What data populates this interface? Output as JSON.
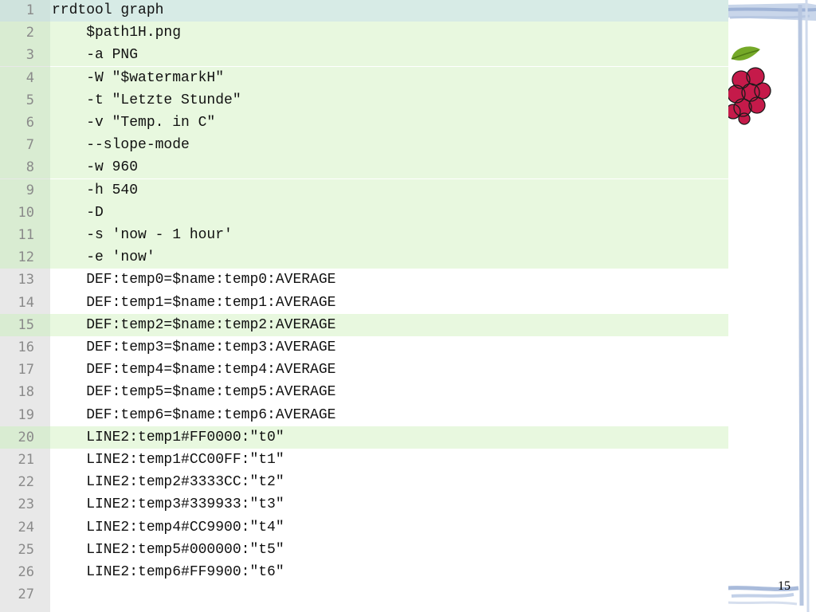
{
  "editor": {
    "lines": [
      {
        "no": "1",
        "text": "rrdtool graph"
      },
      {
        "no": "2",
        "text": "    $path1H.png"
      },
      {
        "no": "3",
        "text": "    -a PNG"
      },
      {
        "no": "4",
        "text": "    -W \"$watermarkH\""
      },
      {
        "no": "5",
        "text": "    -t \"Letzte Stunde\""
      },
      {
        "no": "6",
        "text": "    -v \"Temp. in C\""
      },
      {
        "no": "7",
        "text": "    --slope-mode"
      },
      {
        "no": "8",
        "text": "    -w 960"
      },
      {
        "no": "9",
        "text": "    -h 540"
      },
      {
        "no": "10",
        "text": "    -D"
      },
      {
        "no": "11",
        "text": "    -s 'now - 1 hour'"
      },
      {
        "no": "12",
        "text": "    -e 'now'"
      },
      {
        "no": "13",
        "text": "    DEF:temp0=$name:temp0:AVERAGE"
      },
      {
        "no": "14",
        "text": "    DEF:temp1=$name:temp1:AVERAGE"
      },
      {
        "no": "15",
        "text": "    DEF:temp2=$name:temp2:AVERAGE"
      },
      {
        "no": "16",
        "text": "    DEF:temp3=$name:temp3:AVERAGE"
      },
      {
        "no": "17",
        "text": "    DEF:temp4=$name:temp4:AVERAGE"
      },
      {
        "no": "18",
        "text": "    DEF:temp5=$name:temp5:AVERAGE"
      },
      {
        "no": "19",
        "text": "    DEF:temp6=$name:temp6:AVERAGE"
      },
      {
        "no": "20",
        "text": "    LINE2:temp1#FF0000:\"t0\""
      },
      {
        "no": "21",
        "text": "    LINE2:temp1#CC00FF:\"t1\""
      },
      {
        "no": "22",
        "text": "    LINE2:temp2#3333CC:\"t2\""
      },
      {
        "no": "23",
        "text": "    LINE2:temp3#339933:\"t3\""
      },
      {
        "no": "24",
        "text": "    LINE2:temp4#CC9900:\"t4\""
      },
      {
        "no": "25",
        "text": "    LINE2:temp5#000000:\"t5\""
      },
      {
        "no": "26",
        "text": "    LINE2:temp6#FF9900:\"t6\""
      },
      {
        "no": "27",
        "text": ""
      }
    ]
  },
  "slide": {
    "page_number": "15"
  },
  "icons": {
    "logo": "raspberry-logo-icon"
  }
}
